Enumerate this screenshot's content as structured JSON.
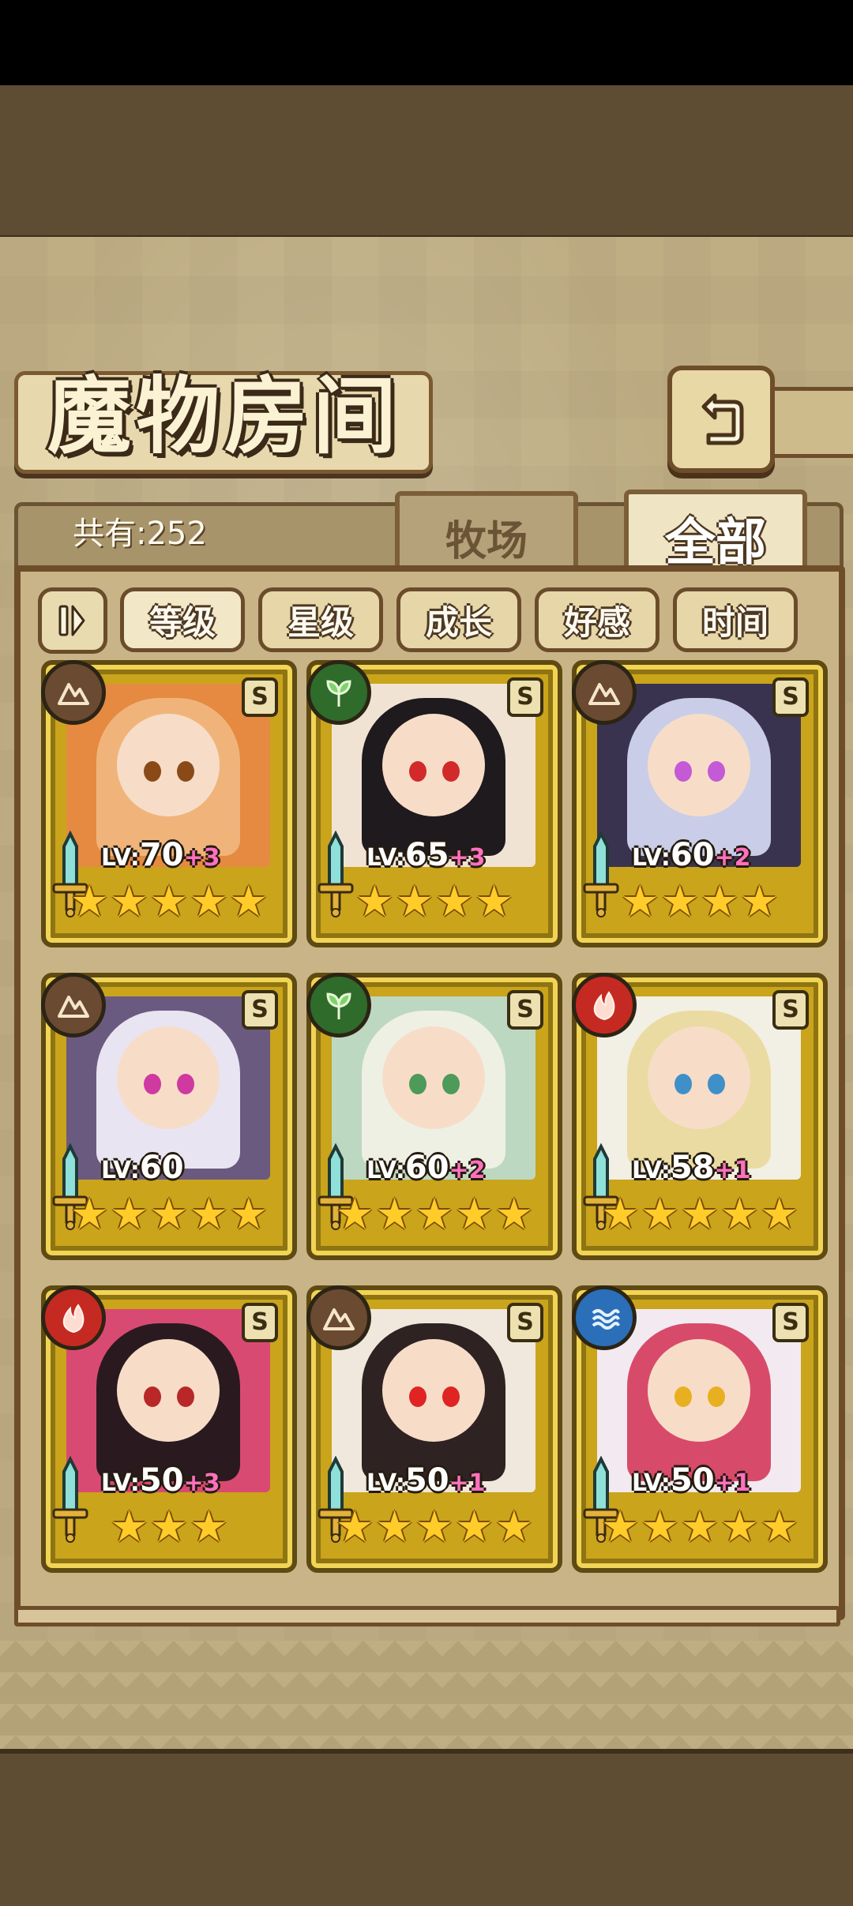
{
  "header": {
    "title": "魔物房间",
    "back_icon": "return-arrow-icon"
  },
  "summary": {
    "count_text": "共有:252"
  },
  "tabs": [
    {
      "label": "牧场",
      "active": false
    },
    {
      "label": "全部",
      "active": true
    }
  ],
  "sort_toggle_icon": "pause-bars-icon",
  "filters": [
    {
      "label": "等级",
      "active": true
    },
    {
      "label": "星级",
      "active": false
    },
    {
      "label": "成长",
      "active": false
    },
    {
      "label": "好感",
      "active": false
    },
    {
      "label": "时间",
      "active": false
    }
  ],
  "monsters": [
    {
      "level_prefix": "LV:",
      "level": "70",
      "bonus": "+3",
      "stars": 5,
      "element": "earth",
      "rank": "S",
      "colors": {
        "hair": "#f0b47b",
        "eye": "#8a4a18",
        "bg": "#e58a40",
        "elem": "#6b4a32"
      }
    },
    {
      "level_prefix": "LV:",
      "level": "65",
      "bonus": "+3",
      "stars": 4,
      "element": "wood",
      "rank": "S",
      "colors": {
        "hair": "#1e1a1e",
        "eye": "#d22a2a",
        "bg": "#f1e3d4",
        "elem": "#2f6b2a"
      }
    },
    {
      "level_prefix": "LV:",
      "level": "60",
      "bonus": "+2",
      "stars": 4,
      "element": "earth",
      "rank": "S",
      "colors": {
        "hair": "#c9cde8",
        "eye": "#c45ad6",
        "bg": "#3a3350",
        "elem": "#6b4a32"
      }
    },
    {
      "level_prefix": "LV:",
      "level": "60",
      "bonus": "",
      "stars": 5,
      "element": "earth",
      "rank": "S",
      "colors": {
        "hair": "#e9e4f2",
        "eye": "#cf3aa0",
        "bg": "#6b5a80",
        "elem": "#6b4a32"
      }
    },
    {
      "level_prefix": "LV:",
      "level": "60",
      "bonus": "+2",
      "stars": 5,
      "element": "wood",
      "rank": "S",
      "colors": {
        "hair": "#eef0e4",
        "eye": "#4d9a5a",
        "bg": "#bdd8c1",
        "elem": "#2f6b2a"
      }
    },
    {
      "level_prefix": "LV:",
      "level": "58",
      "bonus": "+1",
      "stars": 5,
      "element": "fire",
      "rank": "S",
      "colors": {
        "hair": "#eadba2",
        "eye": "#3f90c8",
        "bg": "#f2efe5",
        "elem": "#c52a22"
      }
    },
    {
      "level_prefix": "LV:",
      "level": "50",
      "bonus": "+3",
      "stars": 3,
      "element": "fire",
      "rank": "S",
      "colors": {
        "hair": "#2a1a20",
        "eye": "#b82828",
        "bg": "#d94a72",
        "elem": "#c52a22"
      }
    },
    {
      "level_prefix": "LV:",
      "level": "50",
      "bonus": "+1",
      "stars": 5,
      "element": "earth",
      "rank": "S",
      "colors": {
        "hair": "#2e2222",
        "eye": "#e02424",
        "bg": "#f0e8dc",
        "elem": "#6b4a32"
      }
    },
    {
      "level_prefix": "LV:",
      "level": "50",
      "bonus": "+1",
      "stars": 5,
      "element": "water",
      "rank": "S",
      "colors": {
        "hair": "#d84a6a",
        "eye": "#e8b020",
        "bg": "#f2eaf0",
        "elem": "#2a6fb8"
      }
    }
  ]
}
